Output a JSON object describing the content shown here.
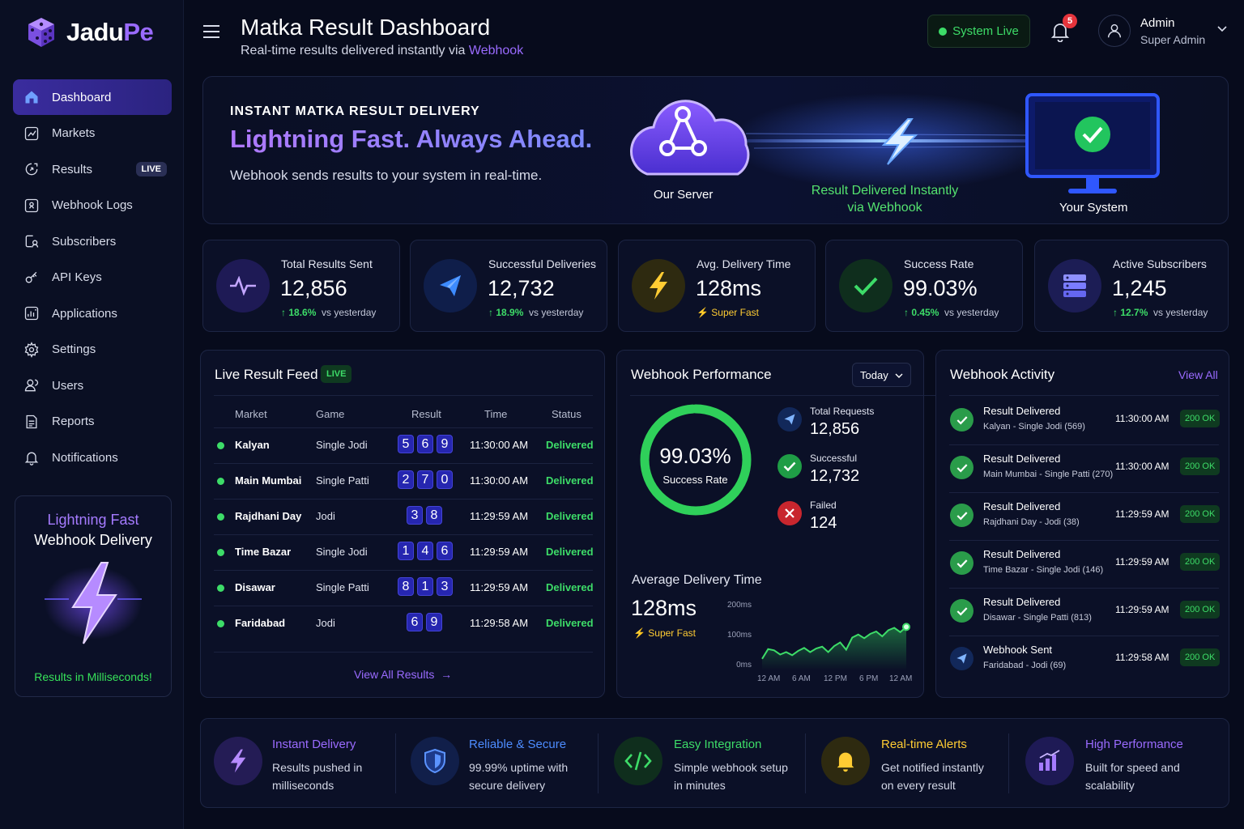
{
  "app": {
    "brand_first": "Jadu",
    "brand_second": "Pe"
  },
  "sidebar": {
    "items": [
      {
        "label": "Dashboard",
        "icon": "home-icon"
      },
      {
        "label": "Markets",
        "icon": "markets-icon"
      },
      {
        "label": "Results",
        "icon": "results-icon",
        "badge": "LIVE"
      },
      {
        "label": "Webhook Logs",
        "icon": "webhook-logs-icon"
      },
      {
        "label": "Subscribers",
        "icon": "subscribers-icon"
      },
      {
        "label": "API Keys",
        "icon": "api-keys-icon"
      },
      {
        "label": "Applications",
        "icon": "applications-icon"
      },
      {
        "label": "Settings",
        "icon": "gear-icon"
      },
      {
        "label": "Users",
        "icon": "users-icon"
      },
      {
        "label": "Reports",
        "icon": "reports-icon"
      },
      {
        "label": "Notifications",
        "icon": "bell-icon"
      }
    ],
    "promo": {
      "title1": "Lightning Fast",
      "title2": "Webhook Delivery",
      "footer": "Results in Milliseconds!"
    }
  },
  "header": {
    "title": "Matka Result Dashboard",
    "subtitle_prefix": "Real-time results delivered instantly via ",
    "subtitle_link": "Webhook",
    "system_status": "System Live",
    "notification_count": "5",
    "user_name": "Admin",
    "user_role": "Super Admin"
  },
  "hero": {
    "kicker": "INSTANT MATKA RESULT DELIVERY",
    "headline": "Lightning Fast. Always Ahead.",
    "description": "Webhook sends results to your system in real-time.",
    "server_label": "Our Server",
    "delivered_line1": "Result Delivered Instantly",
    "delivered_line2": "via Webhook",
    "system_label": "Your System"
  },
  "stats": [
    {
      "label": "Total Results Sent",
      "value": "12,856",
      "change": "18.6%",
      "suffix": "vs yesterday",
      "icon": "pulse-icon",
      "color": "#a57bff"
    },
    {
      "label": "Successful Deliveries",
      "value": "12,732",
      "change": "18.9%",
      "suffix": "vs yesterday",
      "icon": "send-icon",
      "color": "#3d8bff"
    },
    {
      "label": "Avg. Delivery Time",
      "value": "128ms",
      "change": "",
      "suffix": "Super Fast",
      "icon": "bolt-icon",
      "color": "#ffcc33"
    },
    {
      "label": "Success Rate",
      "value": "99.03%",
      "change": "0.45%",
      "suffix": "vs yesterday",
      "icon": "check-icon",
      "color": "#3ddc68"
    },
    {
      "label": "Active Subscribers",
      "value": "1,245",
      "change": "12.7%",
      "suffix": "vs yesterday",
      "icon": "server-icon",
      "color": "#7a7cff"
    }
  ],
  "feed": {
    "title": "Live Result Feed",
    "badge": "LIVE",
    "columns": [
      "Market",
      "Game",
      "Result",
      "Time",
      "Status"
    ],
    "rows": [
      {
        "market": "Kalyan",
        "game": "Single Jodi",
        "result": [
          "5",
          "6",
          "9"
        ],
        "time": "11:30:00 AM",
        "status": "Delivered"
      },
      {
        "market": "Main Mumbai",
        "game": "Single Patti",
        "result": [
          "2",
          "7",
          "0"
        ],
        "time": "11:30:00 AM",
        "status": "Delivered"
      },
      {
        "market": "Rajdhani Day",
        "game": "Jodi",
        "result": [
          "3",
          "8"
        ],
        "time": "11:29:59 AM",
        "status": "Delivered"
      },
      {
        "market": "Time Bazar",
        "game": "Single Jodi",
        "result": [
          "1",
          "4",
          "6"
        ],
        "time": "11:29:59 AM",
        "status": "Delivered"
      },
      {
        "market": "Disawar",
        "game": "Single Patti",
        "result": [
          "8",
          "1",
          "3"
        ],
        "time": "11:29:59 AM",
        "status": "Delivered"
      },
      {
        "market": "Faridabad",
        "game": "Jodi",
        "result": [
          "6",
          "9"
        ],
        "time": "11:29:58 AM",
        "status": "Delivered"
      }
    ],
    "view_all": "View All Results"
  },
  "performance": {
    "title": "Webhook Performance",
    "period": "Today",
    "success_rate": "99.03%",
    "success_rate_fraction": 0.9903,
    "success_rate_label": "Success Rate",
    "metrics": [
      {
        "label": "Total Requests",
        "value": "12,856",
        "icon": "send-icon",
        "color": "#3d8bff"
      },
      {
        "label": "Successful",
        "value": "12,732",
        "icon": "check-icon",
        "color": "#3ddc68"
      },
      {
        "label": "Failed",
        "value": "124",
        "icon": "close-icon",
        "color": "#e5343c"
      }
    ],
    "avg_label": "Average Delivery Time",
    "avg_value": "128ms",
    "avg_tag": "Super Fast"
  },
  "chart_data": {
    "type": "area",
    "title": "",
    "x_ticks": [
      "12 AM",
      "6 AM",
      "12 PM",
      "6 PM",
      "12 AM"
    ],
    "y_ticks": [
      "200ms",
      "100ms",
      "0ms"
    ],
    "ylim": [
      0,
      200
    ],
    "x": [
      0,
      1,
      2,
      3,
      4,
      5,
      6,
      7,
      8,
      9,
      10,
      11,
      12,
      13,
      14,
      15,
      16,
      17,
      18,
      19,
      20,
      21,
      22,
      23,
      24
    ],
    "series": [
      {
        "values": [
          70,
          102,
          98,
          84,
          92,
          82,
          96,
          106,
          92,
          104,
          110,
          92,
          112,
          124,
          100,
          140,
          150,
          138,
          152,
          160,
          144,
          164,
          172,
          158,
          175
        ]
      }
    ],
    "grid": false,
    "color": "#3ddc68"
  },
  "activity": {
    "title": "Webhook Activity",
    "view_all": "View All",
    "items": [
      {
        "title": "Result Delivered",
        "detail": "Kalyan - Single Jodi (569)",
        "time": "11:30:00 AM",
        "status": "200 OK",
        "icon": "check-icon"
      },
      {
        "title": "Result Delivered",
        "detail": "Main Mumbai - Single Patti (270)",
        "time": "11:30:00 AM",
        "status": "200 OK",
        "icon": "check-icon"
      },
      {
        "title": "Result Delivered",
        "detail": "Rajdhani Day - Jodi (38)",
        "time": "11:29:59 AM",
        "status": "200 OK",
        "icon": "check-icon"
      },
      {
        "title": "Result Delivered",
        "detail": "Time Bazar - Single Jodi (146)",
        "time": "11:29:59 AM",
        "status": "200 OK",
        "icon": "check-icon"
      },
      {
        "title": "Result Delivered",
        "detail": "Disawar - Single Patti (813)",
        "time": "11:29:59 AM",
        "status": "200 OK",
        "icon": "check-icon"
      },
      {
        "title": "Webhook Sent",
        "detail": "Faridabad - Jodi (69)",
        "time": "11:29:58 AM",
        "status": "200 OK",
        "icon": "send-icon"
      }
    ]
  },
  "features": [
    {
      "title": "Instant Delivery",
      "line1": "Results pushed in",
      "line2": "milliseconds",
      "color": "#9a6bff",
      "icon": "bolt-icon"
    },
    {
      "title": "Reliable & Secure",
      "line1": "99.99% uptime with",
      "line2": "secure delivery",
      "color": "#4d8cff",
      "icon": "shield-icon"
    },
    {
      "title": "Easy Integration",
      "line1": "Simple webhook setup",
      "line2": "in minutes",
      "color": "#3ddc68",
      "icon": "code-icon"
    },
    {
      "title": "Real-time Alerts",
      "line1": "Get notified instantly",
      "line2": "on every result",
      "color": "#ffcc33",
      "icon": "bell-icon"
    },
    {
      "title": "High Performance",
      "line1": "Built for speed and",
      "line2": "scalability",
      "color": "#9a6bff",
      "icon": "bar-chart-icon"
    }
  ]
}
